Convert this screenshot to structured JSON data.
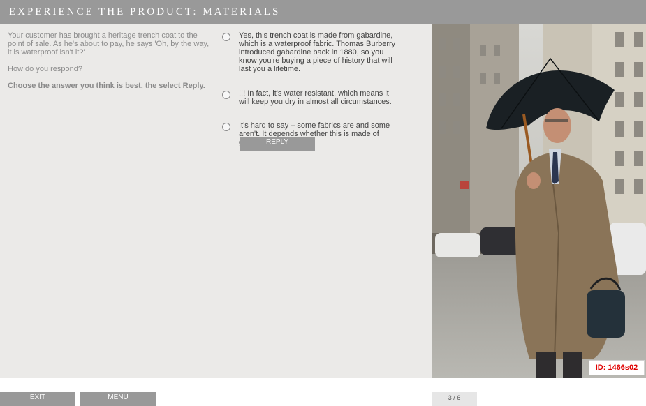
{
  "header": {
    "title": "Experience the product: Materials"
  },
  "scenario": {
    "text": "Your customer has brought a heritage trench coat to the point of sale. As he's about to pay, he says 'Oh, by the way, it is waterproof isn't it?'",
    "question": "How do you respond?",
    "instruction": "Choose the answer you think is best, the select Reply."
  },
  "options": [
    {
      "text": "Yes, this trench coat is made from gabardine, which is a waterproof fabric. Thomas Burberry introduced gabardine back in 1880, so you know you're buying a piece of history that will last you a lifetime."
    },
    {
      "text": "!!! In fact, it's water resistant, which means it will keep you dry in almost all circumstances."
    },
    {
      "text": "It's hard to say – some fabrics are and some aren't. It depends whether this is made of gabardine or not."
    }
  ],
  "reply_label": "REPLY",
  "id_badge": "ID: 1466s02",
  "footer": {
    "exit_label": "EXIT",
    "menu_label": "MENU",
    "page_indicator": "3 / 6"
  },
  "colors": {
    "header_bg": "#999999",
    "content_bg": "#ebeae8",
    "id_text": "#e00000"
  }
}
